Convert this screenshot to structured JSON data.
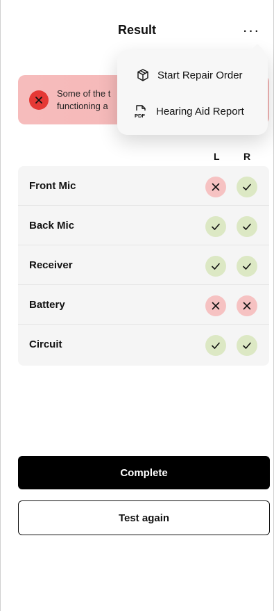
{
  "header": {
    "title": "Result",
    "more_label": "···"
  },
  "alert": {
    "text": "Some of the t\nfunctioning a",
    "icon": "close-icon",
    "color": "#e53935"
  },
  "menu": {
    "items": [
      {
        "label": "Start Repair Order",
        "icon": "package-icon"
      },
      {
        "label": "Hearing Aid Report",
        "icon": "pdf-icon"
      }
    ]
  },
  "columns": {
    "left": "L",
    "right": "R"
  },
  "rows": [
    {
      "label": "Front Mic",
      "left": "fail",
      "right": "pass"
    },
    {
      "label": "Back Mic",
      "left": "pass",
      "right": "pass"
    },
    {
      "label": "Receiver",
      "left": "pass",
      "right": "pass"
    },
    {
      "label": "Battery",
      "left": "fail",
      "right": "fail"
    },
    {
      "label": "Circuit",
      "left": "pass",
      "right": "pass"
    }
  ],
  "buttons": {
    "complete": "Complete",
    "test_again": "Test again"
  },
  "colors": {
    "pass_bg": "#dce8c4",
    "fail_bg": "#f6c2c2",
    "alert_bg": "#f6bcbc"
  }
}
